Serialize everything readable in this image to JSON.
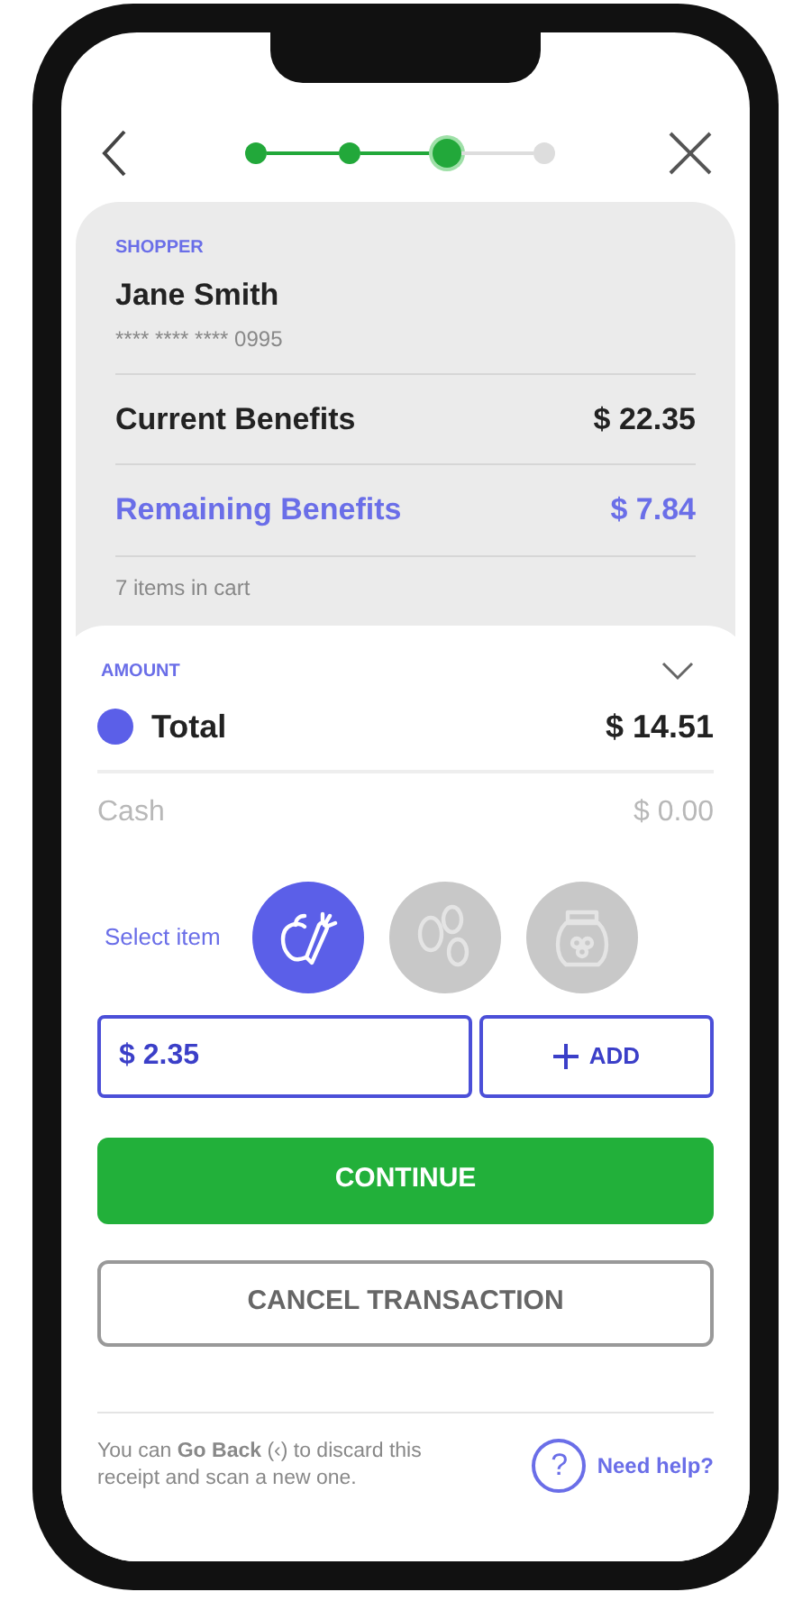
{
  "header": {
    "steps": [
      {
        "completed": true,
        "selected": false
      },
      {
        "completed": true,
        "selected": false
      },
      {
        "completed": true,
        "selected": true
      },
      {
        "completed": false,
        "selected": false
      }
    ]
  },
  "shopper": {
    "label": "SHOPPER",
    "name": "Jane Smith",
    "card": "**** **** **** 0995"
  },
  "benefits": [
    {
      "label": "Current Benefits",
      "value": "$ 22.35",
      "highlighted": false
    },
    {
      "label": "Remaining Benefits",
      "value": "$ 7.84",
      "highlighted": true
    }
  ],
  "cart_count": "7 items in cart",
  "amount": {
    "label": "AMOUNT",
    "expanded": false,
    "rows": [
      {
        "label": "Total",
        "value": "$ 14.51",
        "selected": true,
        "disabled": false
      },
      {
        "label": "Cash",
        "value": "$ 0.00",
        "selected": false,
        "disabled": true
      }
    ]
  },
  "select_item": {
    "label": "Select item",
    "items": [
      {
        "kind": "produce",
        "selected": true
      },
      {
        "kind": "grains",
        "selected": false
      },
      {
        "kind": "jar",
        "selected": false
      }
    ]
  },
  "amount_field": {
    "value": "$ 2.35"
  },
  "add_button": "ADD",
  "continue_button": "CONTINUE",
  "cancel_button": "CANCEL TRANSACTION",
  "footer": {
    "note": "You can **Go Back** (‹) to discard this receipt and scan a new one.",
    "help_icon": "?",
    "help_link": "Need help?"
  }
}
